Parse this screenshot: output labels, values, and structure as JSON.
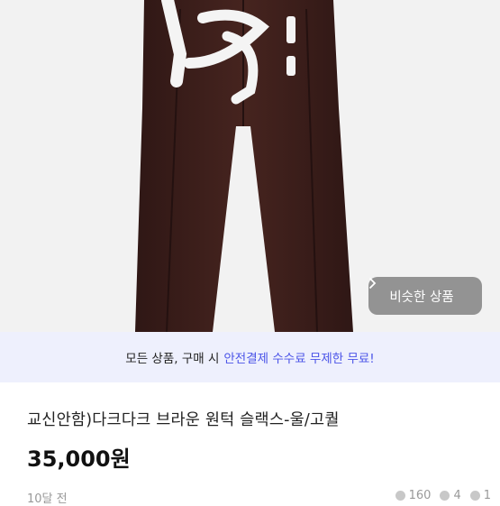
{
  "similar_button": {
    "label": "비슷한 상품",
    "icon": "chevron-right-icon"
  },
  "banner": {
    "prefix": "모든 상품, 구매 시",
    "highlight": "안전결제 수수료 무제한 무료!",
    "highlight_color": "#4b54e8"
  },
  "product": {
    "title": "교신안함)다크다크 브라운 원턱 슬랙스-울/고퀄",
    "price": "35,000원",
    "posted": "10달 전"
  },
  "stats": {
    "views": "160",
    "chats": "4",
    "likes": "1"
  },
  "colors": {
    "pants": "#3b1f1c",
    "banner_bg": "#eef0fd"
  }
}
